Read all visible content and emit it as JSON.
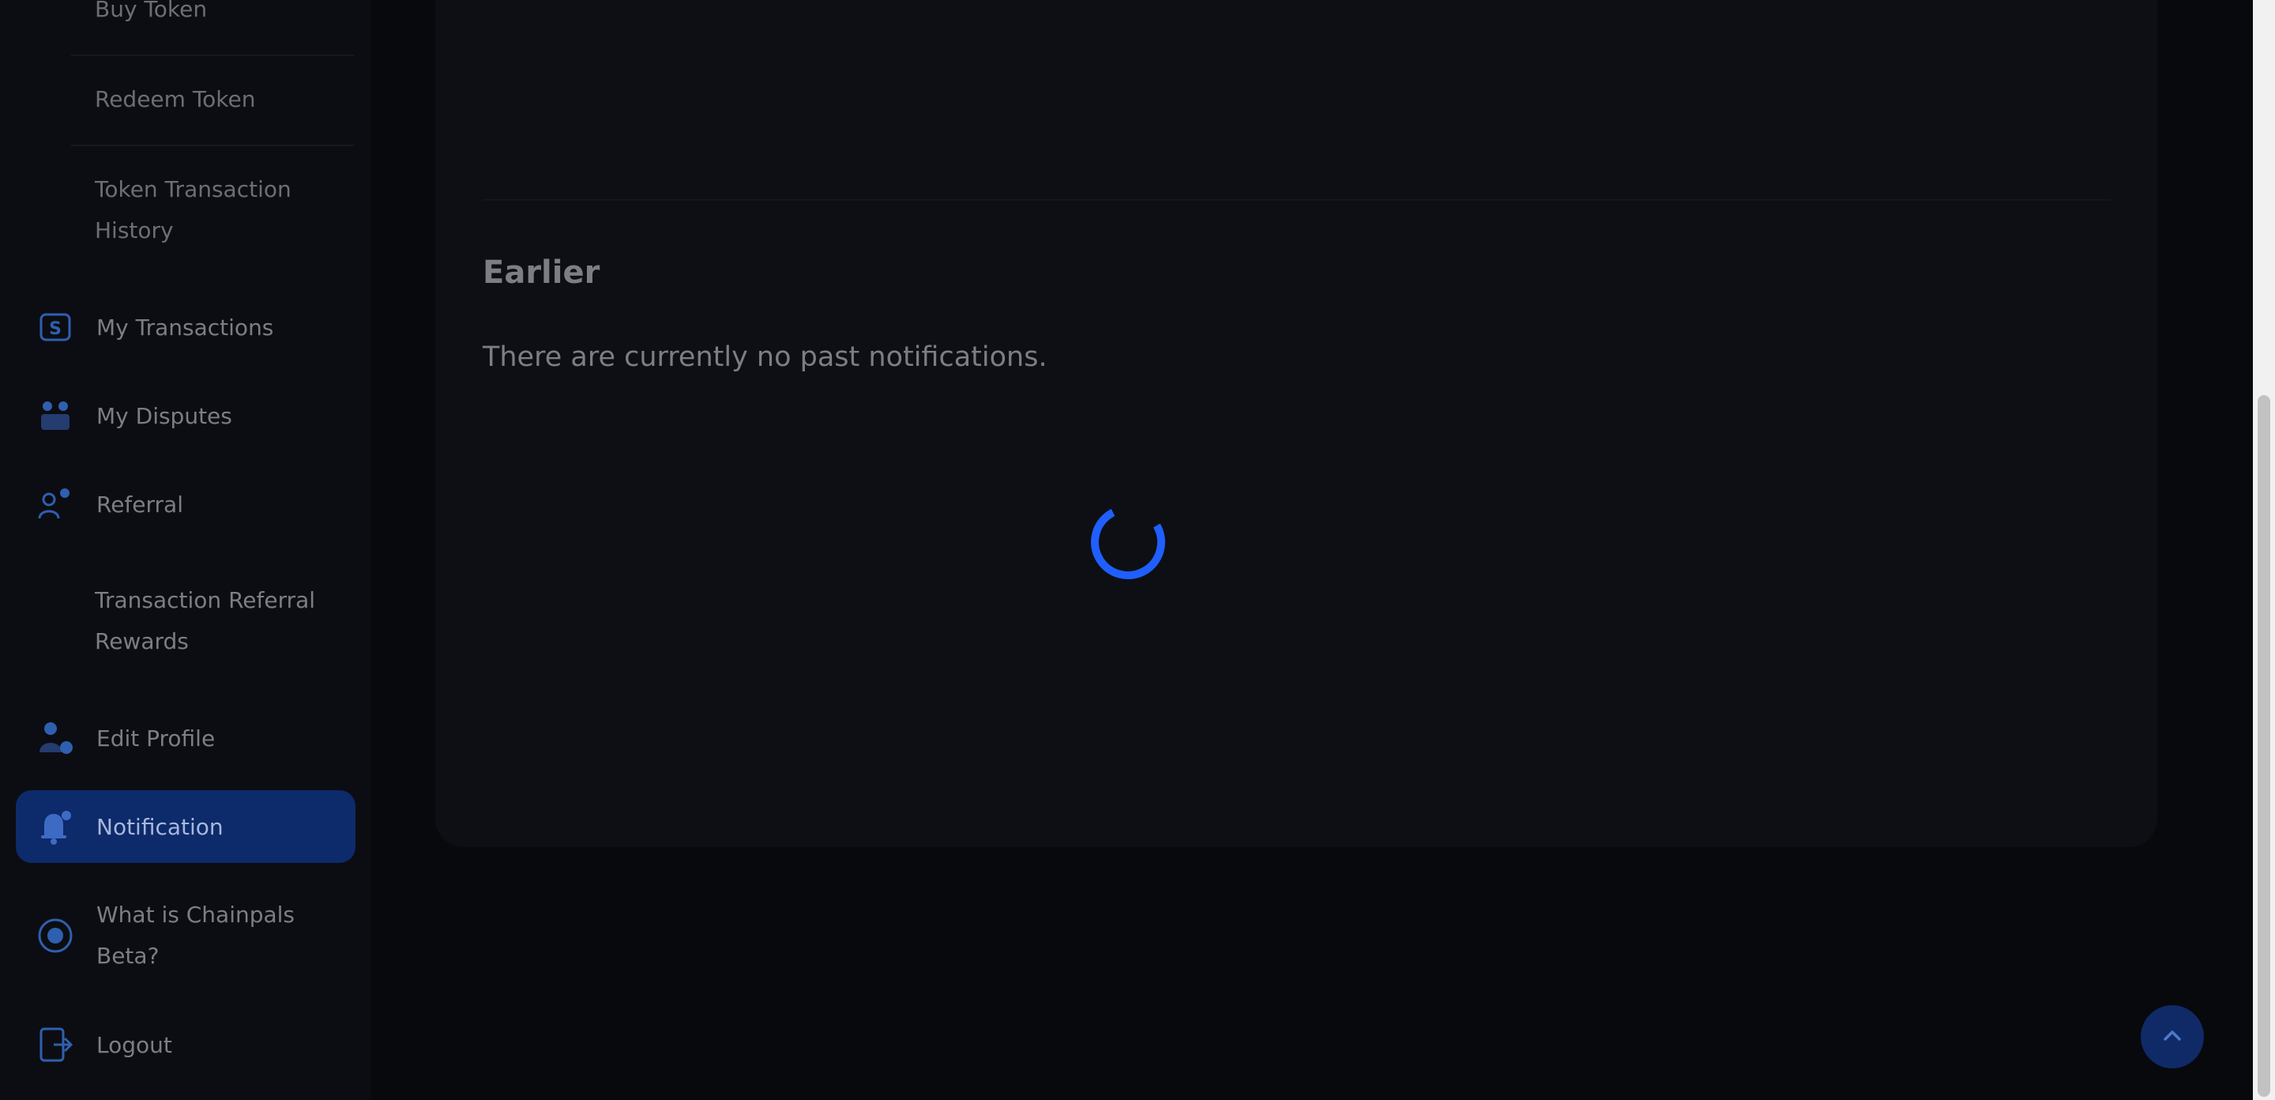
{
  "sidebar": {
    "sub_items": [
      {
        "label": "Buy Token"
      },
      {
        "label": "Redeem Token"
      },
      {
        "label": "Token Transaction History"
      }
    ],
    "items": [
      {
        "label": "My Transactions",
        "icon": "transactions-icon"
      },
      {
        "label": "My Disputes",
        "icon": "disputes-icon"
      },
      {
        "label": "Referral",
        "icon": "referral-icon"
      },
      {
        "label": "Transaction Referral Rewards",
        "icon": ""
      },
      {
        "label": "Edit Profile",
        "icon": "edit-profile-icon"
      },
      {
        "label": "Notification",
        "icon": "bell-icon"
      },
      {
        "label": "What is Chainpals Beta?",
        "icon": "chainpals-icon"
      },
      {
        "label": "Logout",
        "icon": "logout-icon"
      }
    ]
  },
  "main": {
    "section_title": "Earlier",
    "empty_message": "There are currently no past notifications."
  },
  "colors": {
    "accent": "#1f5fff",
    "active_bg": "#0d2a6b",
    "overlay": "#08090d"
  }
}
